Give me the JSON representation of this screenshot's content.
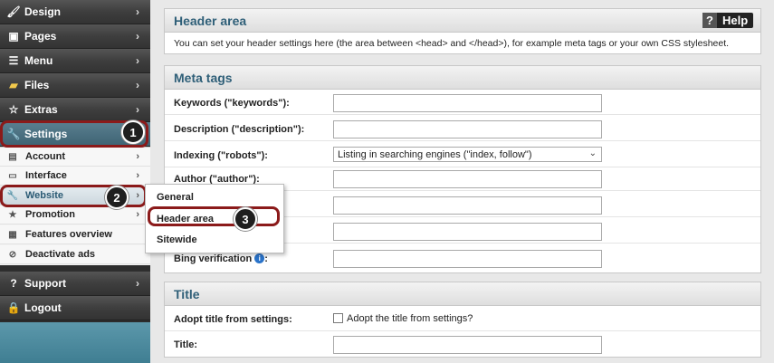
{
  "sidebar": {
    "top_items": [
      {
        "label": "Design",
        "icon": "brush-icon"
      },
      {
        "label": "Pages",
        "icon": "pages-icon"
      },
      {
        "label": "Menu",
        "icon": "menu-list-icon"
      },
      {
        "label": "Files",
        "icon": "folder-icon"
      },
      {
        "label": "Extras",
        "icon": "star-icon"
      },
      {
        "label": "Settings",
        "icon": "wrench-icon"
      }
    ],
    "sub_items": [
      {
        "label": "Account",
        "icon": "account-icon"
      },
      {
        "label": "Interface",
        "icon": "monitor-icon"
      },
      {
        "label": "Website",
        "icon": "wrench-icon"
      },
      {
        "label": "Promotion",
        "icon": "star-icon"
      },
      {
        "label": "Features overview",
        "icon": "grid-icon"
      },
      {
        "label": "Deactivate ads",
        "icon": "block-icon"
      }
    ],
    "bottom_items": [
      {
        "label": "Support",
        "icon": "question-icon"
      },
      {
        "label": "Logout",
        "icon": "lock-icon"
      }
    ]
  },
  "flyout": {
    "items": [
      "General",
      "Header area",
      "Sitewide"
    ]
  },
  "steps": [
    "1",
    "2",
    "3"
  ],
  "header_panel": {
    "title": "Header area",
    "help_label": "Help",
    "description": "You can set your header settings here (the area between <head> and </head>), for example meta tags or your own CSS stylesheet."
  },
  "meta_panel": {
    "title": "Meta tags",
    "fields": {
      "keywords": "Keywords (\"keywords\"):",
      "description": "Description (\"description\"):",
      "indexing": "Indexing (\"robots\"):",
      "author": "Author (\"author\"):",
      "bing": "Bing verification"
    },
    "indexing_value": "Listing in searching engines (\"index, follow\")"
  },
  "title_panel": {
    "title": "Title",
    "adopt_label": "Adopt title from settings:",
    "adopt_checkbox_label": "Adopt the title from settings?",
    "title_label": "Title:"
  },
  "colors": {
    "accent": "#2f5f78",
    "highlight": "#8b1a1a",
    "sidebar_bottom": "#4a8ba0"
  }
}
